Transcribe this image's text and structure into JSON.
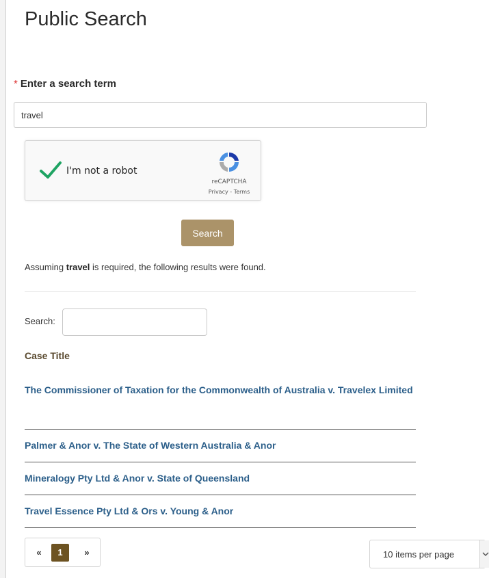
{
  "page": {
    "title": "Public Search"
  },
  "form": {
    "required_marker": "*",
    "label": "Enter a search term",
    "search_value": "travel",
    "search_button": "Search"
  },
  "captcha": {
    "checkbox_label": "I'm not a robot",
    "brand": "reCAPTCHA",
    "links": "Privacy - Terms",
    "checked": true
  },
  "results": {
    "message_prefix": "Assuming ",
    "message_term": "travel",
    "message_suffix": " is required, the following results were found.",
    "filter_label": "Search:",
    "filter_value": "",
    "column_header": "Case Title",
    "rows": [
      "The Commissioner of Taxation for the Commonwealth of Australia v. Travelex Limited",
      "Palmer & Anor v. The State of Western Australia & Anor",
      "Mineralogy Pty Ltd & Anor v. State of Queensland",
      "Travel Essence Pty Ltd & Ors v. Young & Anor"
    ]
  },
  "pagination": {
    "prev": "«",
    "current": "1",
    "next": "»",
    "per_page": "10 items per page"
  },
  "colors": {
    "accent_button": "#ab9369",
    "pager_active": "#6d5322",
    "link": "#2c5f8a"
  }
}
